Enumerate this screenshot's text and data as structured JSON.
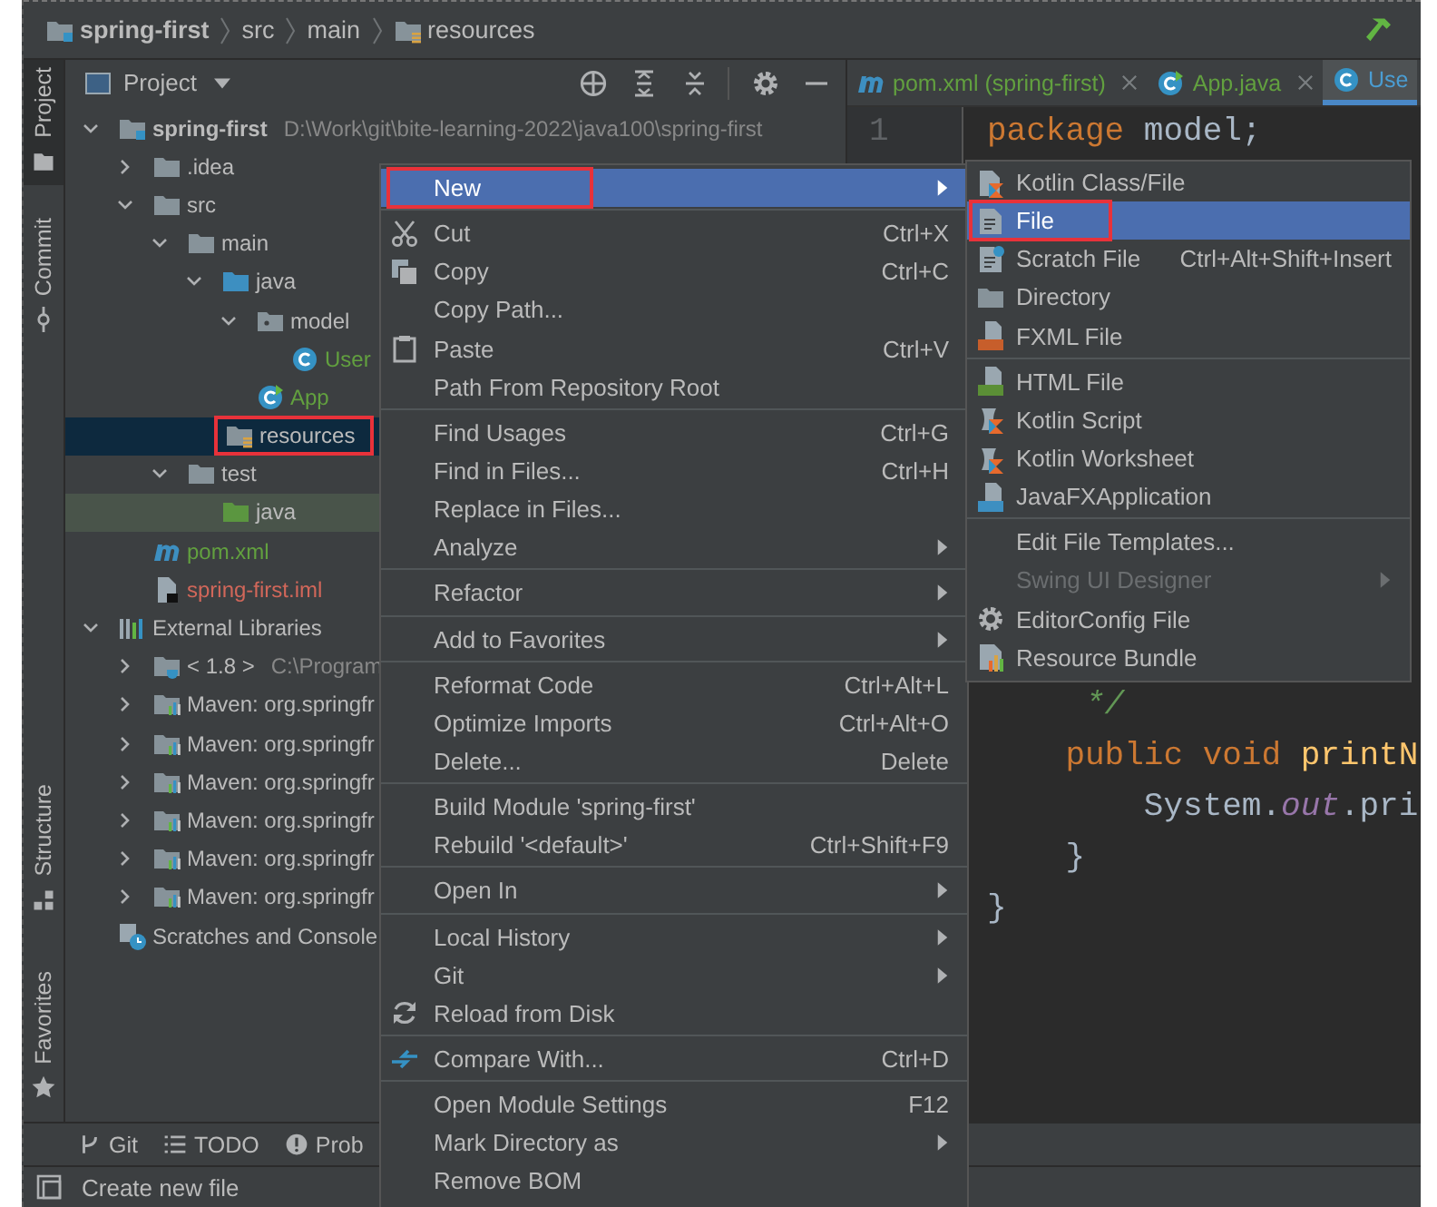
{
  "breadcrumbs": [
    {
      "label": "spring-first",
      "kind": "module"
    },
    {
      "label": "src",
      "kind": "dir"
    },
    {
      "label": "main",
      "kind": "dir"
    },
    {
      "label": "resources",
      "kind": "resources-folder"
    }
  ],
  "tool_stripe": {
    "top": [
      {
        "label": "Project",
        "kind": "stripe-folder",
        "selected": true
      },
      {
        "label": "Commit",
        "kind": "commit",
        "selected": false
      }
    ],
    "bottom": [
      {
        "label": "Structure",
        "kind": "structure",
        "selected": false
      },
      {
        "label": "Favorites",
        "kind": "star",
        "selected": false
      }
    ]
  },
  "project_panel": {
    "title": "Project",
    "tree": [
      {
        "label": "spring-first",
        "kind": "module",
        "detail": "D:\\Work\\git\\bite-learning-2022\\java100\\spring-first",
        "expanded": true,
        "selected": false,
        "children": [
          {
            "label": ".idea",
            "kind": "folder",
            "expanded": false,
            "selected": false
          },
          {
            "label": "src",
            "kind": "folder",
            "expanded": true,
            "selected": false,
            "children": [
              {
                "label": "main",
                "kind": "folder",
                "expanded": true,
                "selected": false,
                "children": [
                  {
                    "label": "java",
                    "kind": "source-folder",
                    "expanded": true,
                    "selected": false,
                    "children": [
                      {
                        "label": "model",
                        "kind": "package",
                        "expanded": true,
                        "selected": false,
                        "children": [
                          {
                            "label": "User",
                            "kind": "class",
                            "color": "#62a03f",
                            "selected": false
                          }
                        ]
                      },
                      {
                        "label": "App",
                        "kind": "class-run",
                        "color": "#62a03f",
                        "selected": false
                      }
                    ]
                  },
                  {
                    "label": "resources",
                    "kind": "resources-folder",
                    "selected": true,
                    "annotated": true
                  }
                ]
              },
              {
                "label": "test",
                "kind": "folder",
                "expanded": true,
                "selected": false,
                "children": [
                  {
                    "label": "java",
                    "kind": "test-folder",
                    "selected": false
                  }
                ]
              }
            ]
          },
          {
            "label": "pom.xml",
            "kind": "maven",
            "color": "#62a03f",
            "selected": false
          },
          {
            "label": "spring-first.iml",
            "kind": "iml",
            "color": "#d1675a",
            "selected": false
          }
        ]
      },
      {
        "label": "External Libraries",
        "kind": "libraries",
        "expanded": true,
        "selected": false,
        "children": [
          {
            "label": "< 1.8 >",
            "kind": "jdk",
            "detail": "C:\\Program",
            "expanded": false,
            "selected": false
          },
          {
            "label": "Maven: org.springfr",
            "kind": "library",
            "expanded": false,
            "selected": false
          },
          {
            "label": "Maven: org.springfr",
            "kind": "library",
            "expanded": false,
            "selected": false
          },
          {
            "label": "Maven: org.springfr",
            "kind": "library",
            "expanded": false,
            "selected": false
          },
          {
            "label": "Maven: org.springfr",
            "kind": "library",
            "expanded": false,
            "selected": false
          },
          {
            "label": "Maven: org.springfr",
            "kind": "library",
            "expanded": false,
            "selected": false
          },
          {
            "label": "Maven: org.springfr",
            "kind": "library",
            "expanded": false,
            "selected": false
          }
        ]
      },
      {
        "label": "Scratches and Console",
        "kind": "scratches",
        "selected": false
      }
    ]
  },
  "editor": {
    "tabs": [
      {
        "label": "pom.xml (spring-first)",
        "kind": "maven",
        "color": "#62a03f",
        "selected": false,
        "closable": true
      },
      {
        "label": "App.java",
        "kind": "class-run",
        "color": "#62a03f",
        "selected": false,
        "closable": true
      },
      {
        "label": "Use",
        "kind": "class",
        "color": "#4a9dd3",
        "selected": true,
        "closable": false
      }
    ],
    "gutter": [
      "1"
    ],
    "code_top": [
      [
        {
          "text": "package",
          "kind": "keyword"
        },
        {
          "text": " model;",
          "kind": "plain"
        }
      ]
    ],
    "code_bottom": [
      [
        {
          "text": "     */",
          "kind": "comment"
        }
      ],
      [
        {
          "text": "    public void",
          "kind": "keyword"
        },
        {
          "text": " printN",
          "kind": "method"
        }
      ],
      [
        {
          "text": "        System.",
          "kind": "plain"
        },
        {
          "text": "out",
          "kind": "field"
        },
        {
          "text": ".pri",
          "kind": "plain"
        }
      ],
      [
        {
          "text": "    }",
          "kind": "plain"
        }
      ],
      [
        {
          "text": "}",
          "kind": "plain"
        }
      ]
    ]
  },
  "bottom_tools": [
    {
      "label": "Git",
      "kind": "branch"
    },
    {
      "label": "TODO",
      "kind": "list"
    },
    {
      "label": "Prob",
      "kind": "problems"
    }
  ],
  "status_bar": {
    "message": "Create new file"
  },
  "context_menu": {
    "sections": [
      [
        {
          "label": "New",
          "submenu": true,
          "selected": true,
          "annotated": true
        }
      ],
      [
        {
          "label": "Cut",
          "kind": "scissors",
          "shortcut": "Ctrl+X",
          "selected": false
        },
        {
          "label": "Copy",
          "kind": "copy",
          "shortcut": "Ctrl+C",
          "selected": false
        },
        {
          "label": "Copy Path...",
          "selected": false
        },
        {
          "label": "Paste",
          "kind": "paste",
          "shortcut": "Ctrl+V",
          "selected": false
        },
        {
          "label": "Path From Repository Root",
          "selected": false
        }
      ],
      [
        {
          "label": "Find Usages",
          "shortcut": "Ctrl+G",
          "selected": false
        },
        {
          "label": "Find in Files...",
          "shortcut": "Ctrl+H",
          "selected": false
        },
        {
          "label": "Replace in Files...",
          "selected": false
        },
        {
          "label": "Analyze",
          "submenu": true,
          "selected": false
        }
      ],
      [
        {
          "label": "Refactor",
          "submenu": true,
          "selected": false
        }
      ],
      [
        {
          "label": "Add to Favorites",
          "submenu": true,
          "selected": false
        }
      ],
      [
        {
          "label": "Reformat Code",
          "shortcut": "Ctrl+Alt+L",
          "selected": false
        },
        {
          "label": "Optimize Imports",
          "shortcut": "Ctrl+Alt+O",
          "selected": false
        },
        {
          "label": "Delete...",
          "shortcut": "Delete",
          "selected": false
        }
      ],
      [
        {
          "label": "Build Module 'spring-first'",
          "selected": false
        },
        {
          "label": "Rebuild '<default>'",
          "shortcut": "Ctrl+Shift+F9",
          "selected": false
        }
      ],
      [
        {
          "label": "Open In",
          "submenu": true,
          "selected": false
        }
      ],
      [
        {
          "label": "Local History",
          "submenu": true,
          "selected": false
        },
        {
          "label": "Git",
          "submenu": true,
          "selected": false
        },
        {
          "label": "Reload from Disk",
          "kind": "reload",
          "selected": false
        }
      ],
      [
        {
          "label": "Compare With...",
          "kind": "compare",
          "shortcut": "Ctrl+D",
          "selected": false
        }
      ],
      [
        {
          "label": "Open Module Settings",
          "shortcut": "F12",
          "selected": false
        },
        {
          "label": "Mark Directory as",
          "submenu": true,
          "selected": false
        },
        {
          "label": "Remove BOM",
          "selected": false
        }
      ]
    ]
  },
  "new_submenu": {
    "sections": [
      [
        {
          "label": "Kotlin Class/File",
          "kind": "kotlin",
          "selected": false
        },
        {
          "label": "File",
          "kind": "file",
          "selected": true,
          "annotated": true
        },
        {
          "label": "Scratch File",
          "kind": "scratch",
          "shortcut": "Ctrl+Alt+Shift+Insert",
          "selected": false
        },
        {
          "label": "Directory",
          "kind": "folder",
          "selected": false
        },
        {
          "label": "FXML File",
          "kind": "fxml",
          "selected": false
        }
      ],
      [
        {
          "label": "HTML File",
          "kind": "html",
          "selected": false
        },
        {
          "label": "Kotlin Script",
          "kind": "kotlin-script",
          "selected": false
        },
        {
          "label": "Kotlin Worksheet",
          "kind": "kotlin-script",
          "selected": false
        },
        {
          "label": "JavaFXApplication",
          "kind": "javafx",
          "selected": false
        }
      ],
      [
        {
          "label": "Edit File Templates...",
          "selected": false
        },
        {
          "label": "Swing UI Designer",
          "submenu": true,
          "disabled": true,
          "selected": false
        },
        {
          "label": "EditorConfig File",
          "kind": "gear",
          "selected": false
        },
        {
          "label": "Resource Bundle",
          "kind": "bundle",
          "selected": false
        }
      ]
    ]
  }
}
